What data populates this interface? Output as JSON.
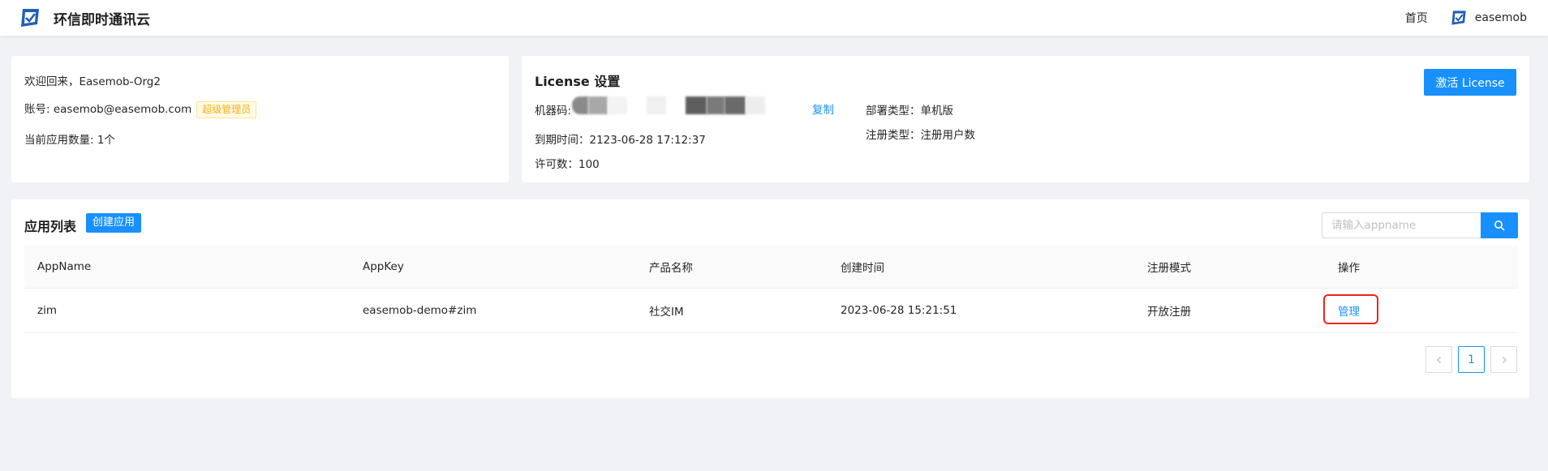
{
  "header": {
    "title": "环信即时通讯云",
    "home_label": "首页",
    "username": "easemob",
    "logo_icon": "easemob-logo-icon",
    "brand_color": "#1f5fb8"
  },
  "welcome": {
    "greeting": "欢迎回来，Easemob-Org2",
    "account": "账号: easemob@easemob.com",
    "role_badge": "超级管理员",
    "app_count": "当前应用数量: 1个"
  },
  "license": {
    "title": "License 设置",
    "machine_code_label": "机器码:",
    "copy_label": "复制",
    "expire": "到期时间：2123-06-28 17:12:37",
    "permit_count": "许可数：100",
    "deploy_type": "部署类型：单机版",
    "register_type": "注册类型：注册用户数",
    "activate_label": "激活 License"
  },
  "apps": {
    "title": "应用列表",
    "create_label": "创建应用",
    "search_placeholder": "请输入appname",
    "columns": [
      "AppName",
      "AppKey",
      "产品名称",
      "创建时间",
      "注册模式",
      "操作"
    ],
    "rows": [
      {
        "appname": "zim",
        "appkey": "easemob-demo#zim",
        "product": "社交IM",
        "created": "2023-06-28 15:21:51",
        "register_mode": "开放注册",
        "action": "管理"
      }
    ],
    "pagination": {
      "current_page": "1"
    }
  },
  "colors": {
    "primary": "#1890ff",
    "highlight_box": "#e8271f",
    "badge_text": "#faad14"
  }
}
